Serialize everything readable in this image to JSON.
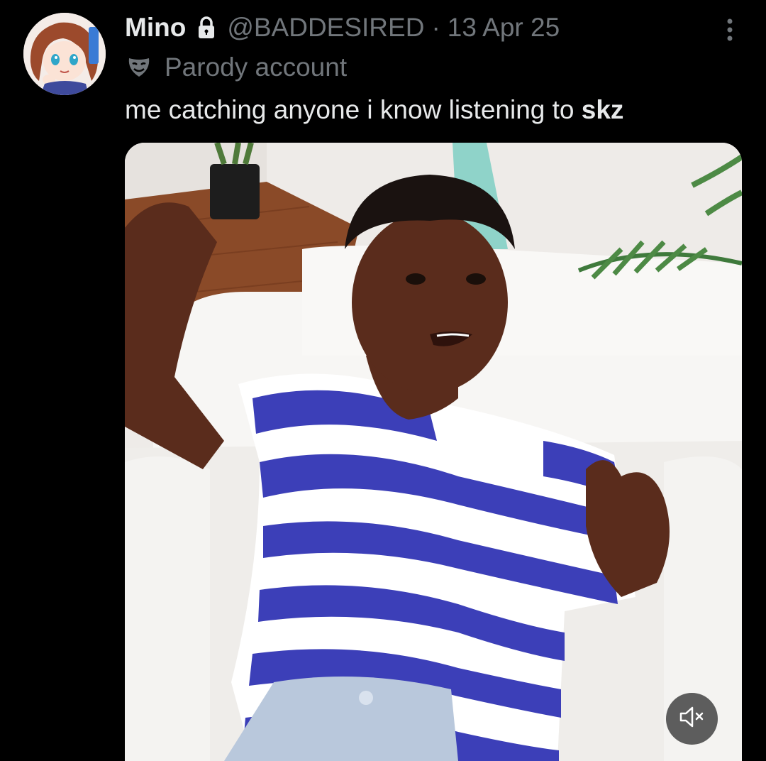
{
  "tweet": {
    "display_name": "Mino",
    "handle": "@BADDESIRED",
    "separator": "·",
    "date": "13 Apr 25",
    "badge_label": "Parody account",
    "text_plain": "me catching anyone i know listening to ",
    "text_bold": "skz"
  },
  "icons": {
    "lock": "lock-icon",
    "more": "more-options-icon",
    "parody": "theater-mask-icon",
    "mute": "muted-speaker-icon"
  },
  "colors": {
    "background": "#000000",
    "primary_text": "#e7e9ea",
    "secondary_text": "#71767b"
  }
}
